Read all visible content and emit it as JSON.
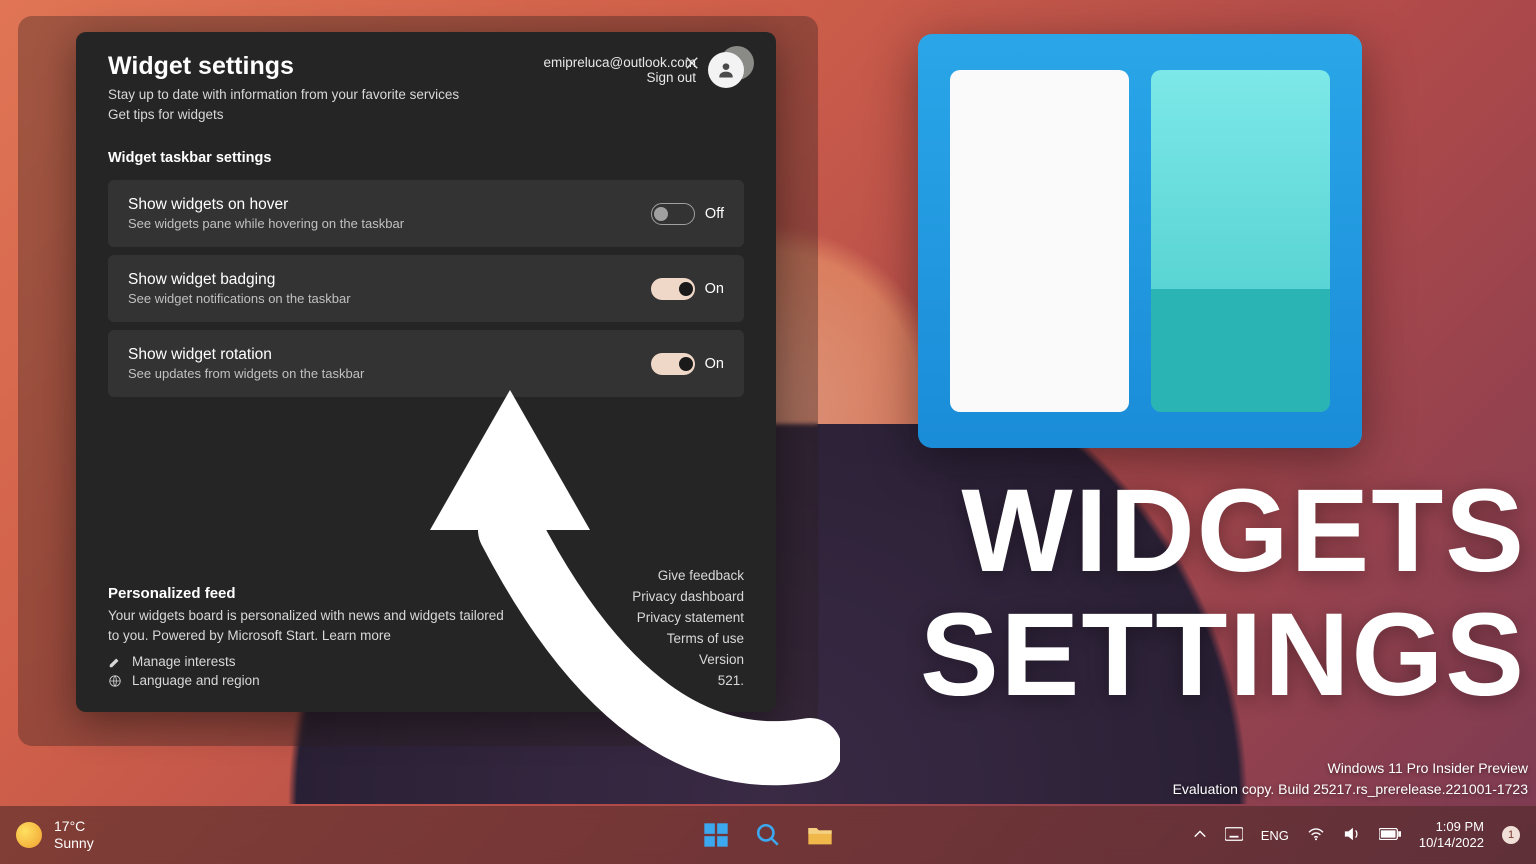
{
  "modal": {
    "title": "Widget settings",
    "subtitle1": "Stay up to date with information from your favorite services",
    "subtitle2": "Get tips for widgets",
    "account_email": "emipreluca@outlook.com",
    "signout": "Sign out",
    "section_label": "Widget taskbar settings",
    "rows": [
      {
        "title": "Show widgets on hover",
        "desc": "See widgets pane while hovering on the taskbar",
        "state": "Off"
      },
      {
        "title": "Show widget badging",
        "desc": "See widget notifications on the taskbar",
        "state": "On"
      },
      {
        "title": "Show widget rotation",
        "desc": "See updates from widgets on the taskbar",
        "state": "On"
      }
    ],
    "feed_title": "Personalized feed",
    "feed_text": "Your widgets board is personalized with news and widgets tailored to you. Powered by Microsoft Start. Learn more",
    "manage_interests": "Manage interests",
    "language_region": "Language and region",
    "links": {
      "feedback": "Give feedback",
      "privacy_dash": "Privacy dashboard",
      "privacy_stmt": "Privacy statement",
      "terms": "Terms of use",
      "version": "Version",
      "build": "521."
    }
  },
  "hero": {
    "line1": "WIDGETS",
    "line2": "SETTINGS"
  },
  "watermark": {
    "line1": "Windows 11 Pro Insider Preview",
    "line2": "Evaluation copy. Build 25217.rs_prerelease.221001-1723"
  },
  "taskbar": {
    "weather_temp": "17°C",
    "weather_cond": "Sunny",
    "lang": "ENG",
    "time": "1:09 PM",
    "date": "10/14/2022",
    "notif_count": "1"
  }
}
